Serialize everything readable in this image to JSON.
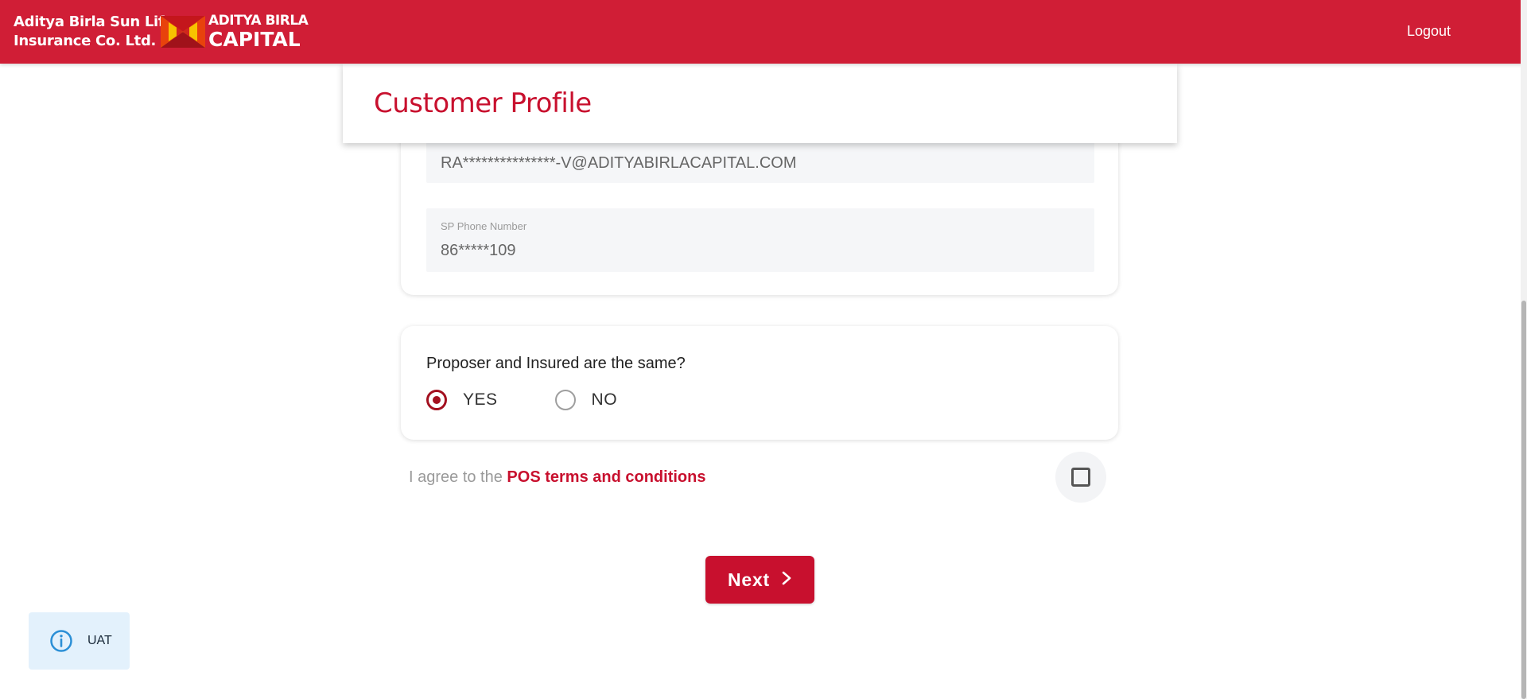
{
  "header": {
    "brand_line1": "Aditya Birla Sun Life",
    "brand_line2": "Insurance Co. Ltd.",
    "logo_line1": "ADITYA BIRLA",
    "logo_line2": "CAPITAL",
    "logout_label": "Logout"
  },
  "profile": {
    "title": "Customer Profile"
  },
  "contact": {
    "email_value": "RA***************-V@ADITYABIRLACAPITAL.COM",
    "phone_label": "SP Phone Number",
    "phone_value": "86*****109"
  },
  "proposer": {
    "question": "Proposer and Insured are the same?",
    "options": [
      "YES",
      "NO"
    ],
    "selected": "YES"
  },
  "terms": {
    "prefix": "I agree to the ",
    "link": "POS terms and conditions",
    "checked": false
  },
  "actions": {
    "next_label": "Next"
  },
  "env_badge": {
    "label": "UAT",
    "icon": "info-icon"
  },
  "colors": {
    "brand_red": "#d01e36",
    "accent_red": "#c8102e",
    "radio_red": "#a3101f",
    "badge_bg": "#e3f1fc",
    "info_blue": "#2b8fd6"
  }
}
